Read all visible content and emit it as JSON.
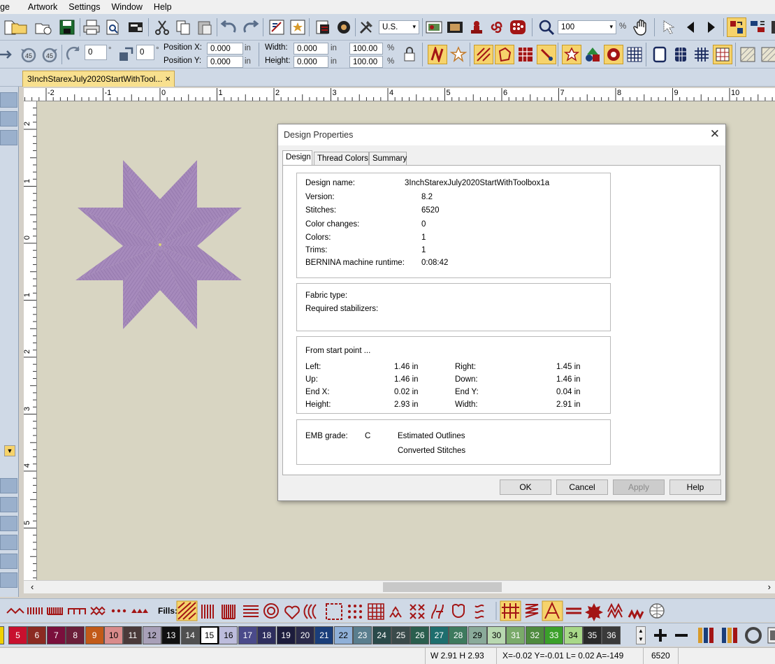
{
  "menu": [
    "ge",
    "Artwork",
    "Settings",
    "Window",
    "Help"
  ],
  "toolbar1": {
    "units_value": "U.S.",
    "zoom_value": "100",
    "zoom_unit": "%"
  },
  "toolbar2": {
    "rotate_left_label": "45",
    "rotate_right_label": "45",
    "rotate_value": "0",
    "rotate_unit": "°",
    "slant_value": "0",
    "slant_unit": "°",
    "position_x_label": "Position X:",
    "position_x_value": "0.000",
    "position_y_label": "Position Y:",
    "position_y_value": "0.000",
    "pos_unit": "in",
    "width_label": "Width:",
    "width_value": "0.000",
    "height_label": "Height:",
    "height_value": "0.000",
    "size_unit": "in",
    "width_pct": "100.00",
    "height_pct": "100.00",
    "pct_unit": "%"
  },
  "document_tab": {
    "title": "3InchStarexJuly2020StartWithTool...",
    "close": "×"
  },
  "ruler_top_labels": [
    "-2",
    "-1",
    "0",
    "1",
    "2",
    "3",
    "4",
    "5",
    "6",
    "7",
    "8",
    "9",
    "10"
  ],
  "ruler_left_labels": [
    "2",
    "1",
    "0",
    "1",
    "2",
    "3",
    "4",
    "5"
  ],
  "dialog": {
    "title": "Design Properties",
    "close": "✕",
    "tabs": [
      "Design",
      "Thread Colors",
      "Summary"
    ],
    "active_tab": "Design",
    "info": [
      {
        "label": "Design name:",
        "value": "3InchStarexJuly2020StartWithToolbox1a"
      },
      {
        "label": "Version:",
        "value": "8.2"
      },
      {
        "label": "Stitches:",
        "value": "6520"
      },
      {
        "label": "Color changes:",
        "value": "0"
      },
      {
        "label": "Colors:",
        "value": "1"
      },
      {
        "label": "Trims:",
        "value": "1"
      },
      {
        "label": "BERNINA machine runtime:",
        "value": "0:08:42"
      }
    ],
    "fabric": {
      "fabric_type_label": "Fabric type:",
      "stabilizers_label": "Required stabilizers:"
    },
    "extent": {
      "heading": "From start point ...",
      "rows": [
        {
          "l1": "Left:",
          "v1": "1.46 in",
          "l2": "Right:",
          "v2": "1.45 in"
        },
        {
          "l1": "Up:",
          "v1": "1.46 in",
          "l2": "Down:",
          "v2": "1.46 in"
        },
        {
          "l1": "End X:",
          "v1": "0.02 in",
          "l2": "End Y:",
          "v2": "0.04 in"
        },
        {
          "l1": "Height:",
          "v1": "2.93 in",
          "l2": "Width:",
          "v2": "2.91 in"
        }
      ]
    },
    "grade": {
      "label": "EMB grade:",
      "value": "C",
      "line1": "Estimated Outlines",
      "line2": "Converted Stitches"
    },
    "buttons": {
      "ok": "OK",
      "cancel": "Cancel",
      "apply": "Apply",
      "help": "Help"
    }
  },
  "stitchbar": {
    "fills_label": "Fills:"
  },
  "palette": [
    {
      "n": "5",
      "c": "#c8102e"
    },
    {
      "n": "6",
      "c": "#8b2a22"
    },
    {
      "n": "7",
      "c": "#7a0f3c"
    },
    {
      "n": "8",
      "c": "#6b1f3a"
    },
    {
      "n": "9",
      "c": "#c25a18"
    },
    {
      "n": "10",
      "c": "#d98b8b"
    },
    {
      "n": "11",
      "c": "#4a3a3a"
    },
    {
      "n": "12",
      "c": "#a8a0b8"
    },
    {
      "n": "13",
      "c": "#101010"
    },
    {
      "n": "14",
      "c": "#505050"
    },
    {
      "n": "15",
      "c": "#ffffff"
    },
    {
      "n": "16",
      "c": "#bcbcdc"
    },
    {
      "n": "17",
      "c": "#4a4a8a"
    },
    {
      "n": "18",
      "c": "#2e2e5e"
    },
    {
      "n": "19",
      "c": "#1c1c3c"
    },
    {
      "n": "20",
      "c": "#2a2a4a"
    },
    {
      "n": "21",
      "c": "#1a3e7a"
    },
    {
      "n": "22",
      "c": "#8fb0d8"
    },
    {
      "n": "23",
      "c": "#5a7e8e"
    },
    {
      "n": "24",
      "c": "#2a4a4a"
    },
    {
      "n": "25",
      "c": "#3a4a4a"
    },
    {
      "n": "26",
      "c": "#2a5e4e"
    },
    {
      "n": "27",
      "c": "#1e6e6e"
    },
    {
      "n": "28",
      "c": "#3e7a5e"
    },
    {
      "n": "29",
      "c": "#8aaa9a"
    },
    {
      "n": "30",
      "c": "#b8d8b0"
    },
    {
      "n": "31",
      "c": "#7aaa6a"
    },
    {
      "n": "32",
      "c": "#4e8a3e"
    },
    {
      "n": "33",
      "c": "#3aa02a"
    },
    {
      "n": "34",
      "c": "#a8d888"
    },
    {
      "n": "35",
      "c": "#2a2a2a"
    },
    {
      "n": "36",
      "c": "#3a3a3a"
    }
  ],
  "status": {
    "size": "W 2.91 H 2.93",
    "coords": "X=-0.02 Y=-0.01 L= 0.02 A=-149",
    "stitches": "6520"
  },
  "colors": {
    "star_fill": "#a589bb",
    "star_dark": "#8f73a8",
    "canvas": "#d8d5c2",
    "toolbar": "#cfd9e6",
    "accent_yellow": "#f6d36b",
    "icon_red": "#a31515"
  }
}
